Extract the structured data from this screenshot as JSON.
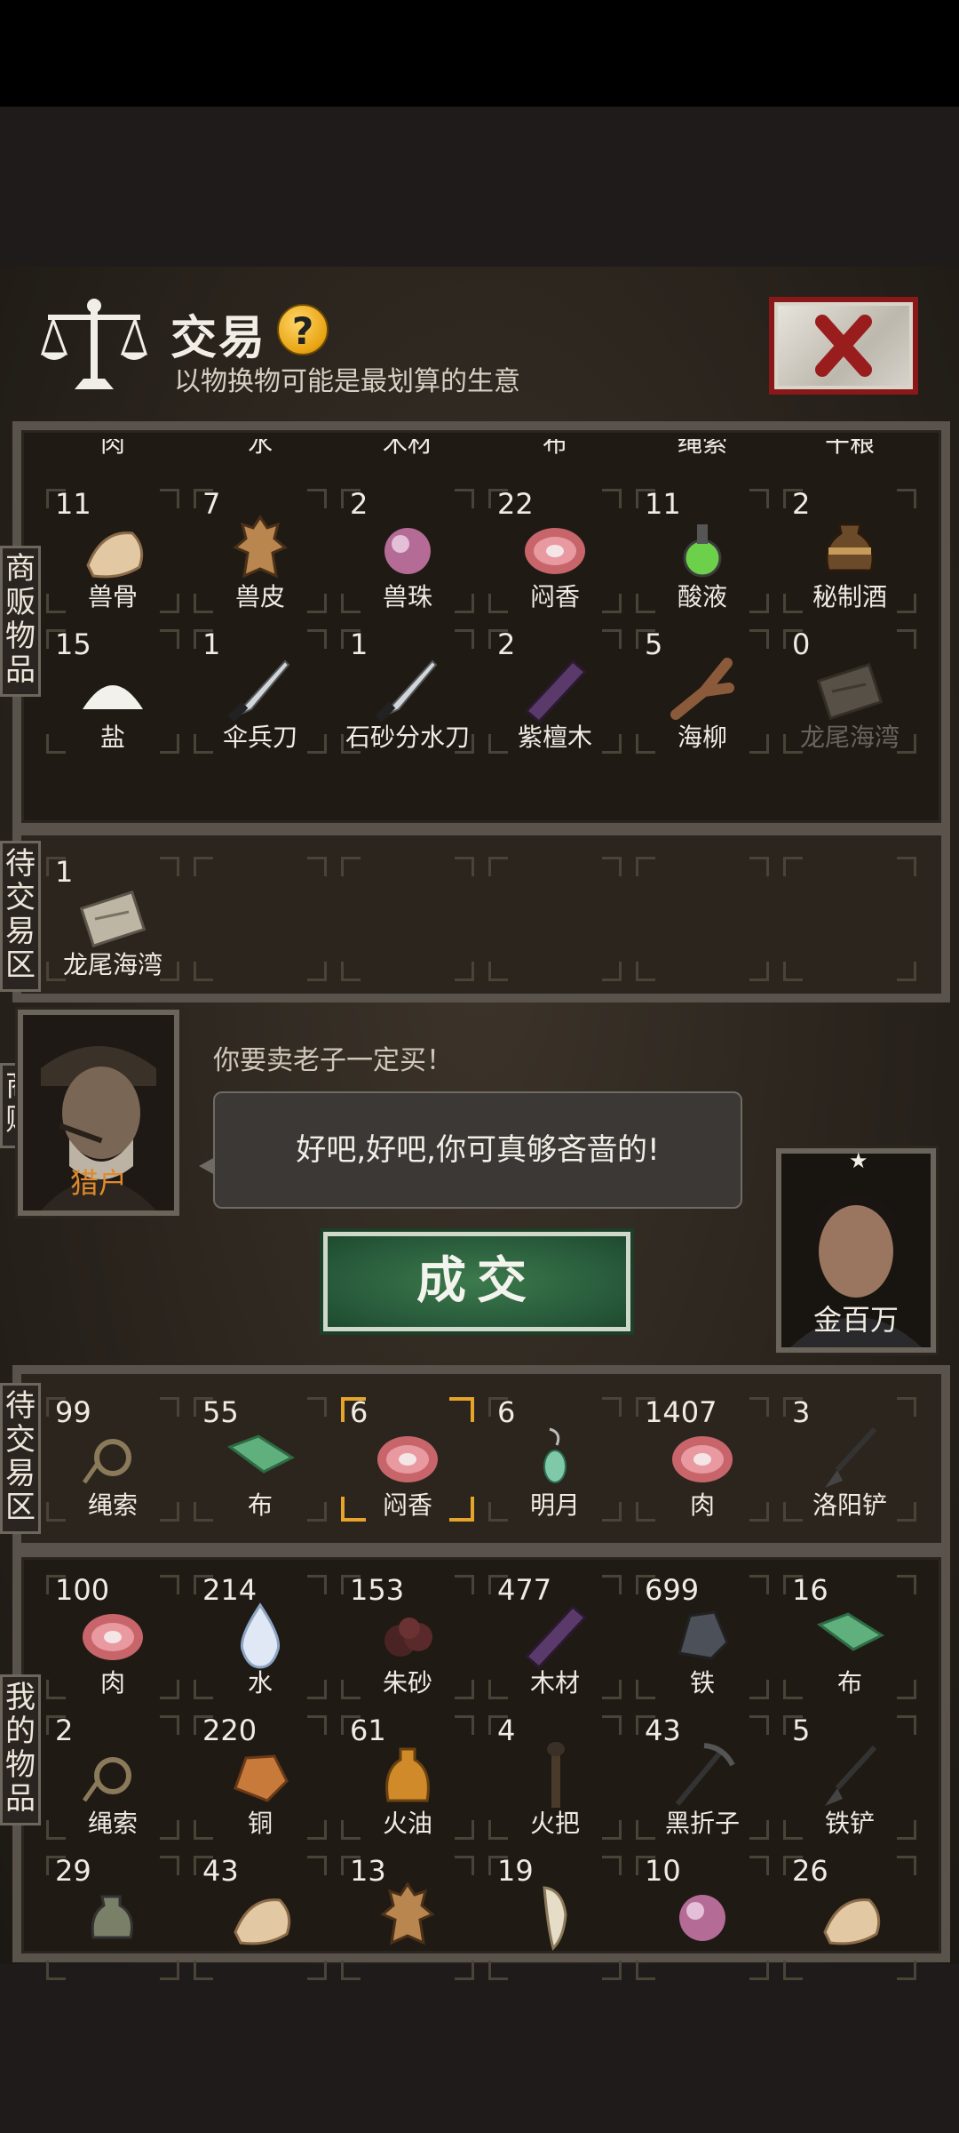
{
  "header": {
    "title": "交易",
    "subtitle": "以物换物可能是最划算的生意",
    "help_label": "?"
  },
  "merchant_goods": {
    "label": "商贩物品",
    "cut_row": [
      "肉",
      "水",
      "木材",
      "布",
      "绳索",
      "干粮"
    ],
    "items": [
      {
        "count": "11",
        "name": "兽骨",
        "icon": "bone-icon"
      },
      {
        "count": "7",
        "name": "兽皮",
        "icon": "hide-icon"
      },
      {
        "count": "2",
        "name": "兽珠",
        "icon": "pearl-icon"
      },
      {
        "count": "22",
        "name": "闷香",
        "icon": "meat-icon"
      },
      {
        "count": "11",
        "name": "酸液",
        "icon": "potion-icon"
      },
      {
        "count": "2",
        "name": "秘制酒",
        "icon": "wine-jar-icon"
      },
      {
        "count": "15",
        "name": "盐",
        "icon": "salt-icon"
      },
      {
        "count": "1",
        "name": "伞兵刀",
        "icon": "knife-icon"
      },
      {
        "count": "1",
        "name": "石砂分水刀",
        "icon": "knife-icon"
      },
      {
        "count": "2",
        "name": "紫檀木",
        "icon": "wood-icon"
      },
      {
        "count": "5",
        "name": "海柳",
        "icon": "branch-icon"
      },
      {
        "count": "0",
        "name": "龙尾海湾",
        "icon": "map-icon"
      }
    ]
  },
  "merchant_pending": {
    "label": "待交易区",
    "items": [
      {
        "count": "1",
        "name": "龙尾海湾",
        "icon": "map-icon"
      }
    ]
  },
  "merchant": {
    "label": "商贩",
    "name": "猎户",
    "quote": "你要卖老子一定买！",
    "speech": "好吧,好吧,你可真够吝啬的!"
  },
  "player": {
    "name": "金百万",
    "star": "★"
  },
  "deal_button": "成交",
  "player_pending": {
    "label": "待交易区",
    "items": [
      {
        "count": "99",
        "name": "绳索",
        "icon": "rope-icon"
      },
      {
        "count": "55",
        "name": "布",
        "icon": "cloth-icon"
      },
      {
        "count": "6",
        "name": "闷香",
        "icon": "meat-icon",
        "selected": true
      },
      {
        "count": "6",
        "name": "明月",
        "icon": "earring-icon"
      },
      {
        "count": "1407",
        "name": "肉",
        "icon": "meat-icon"
      },
      {
        "count": "3",
        "name": "洛阳铲",
        "icon": "shovel-icon"
      }
    ]
  },
  "my_goods": {
    "label": "我的物品",
    "items": [
      {
        "count": "100",
        "name": "肉",
        "icon": "meat-icon"
      },
      {
        "count": "214",
        "name": "水",
        "icon": "water-drop-icon"
      },
      {
        "count": "153",
        "name": "朱砂",
        "icon": "cinnabar-icon"
      },
      {
        "count": "477",
        "name": "木材",
        "icon": "wood-icon"
      },
      {
        "count": "699",
        "name": "铁",
        "icon": "iron-ore-icon"
      },
      {
        "count": "16",
        "name": "布",
        "icon": "cloth-icon"
      },
      {
        "count": "2",
        "name": "绳索",
        "icon": "rope-icon"
      },
      {
        "count": "220",
        "name": "铜",
        "icon": "copper-ore-icon"
      },
      {
        "count": "61",
        "name": "火油",
        "icon": "oil-bottle-icon"
      },
      {
        "count": "4",
        "name": "火把",
        "icon": "torch-icon"
      },
      {
        "count": "43",
        "name": "黑折子",
        "icon": "pickaxe-icon"
      },
      {
        "count": "5",
        "name": "铁铲",
        "icon": "shovel-icon"
      },
      {
        "count": "29",
        "name": "",
        "icon": "flask-icon"
      },
      {
        "count": "43",
        "name": "",
        "icon": "bone-icon"
      },
      {
        "count": "13",
        "name": "",
        "icon": "hide-icon"
      },
      {
        "count": "19",
        "name": "",
        "icon": "tooth-icon"
      },
      {
        "count": "10",
        "name": "",
        "icon": "pearl-icon"
      },
      {
        "count": "26",
        "name": "",
        "icon": "bone-icon"
      }
    ]
  },
  "colors": {
    "accent_orange": "#e6a52a",
    "deal_green": "#27593a",
    "close_red": "#8a1818"
  }
}
